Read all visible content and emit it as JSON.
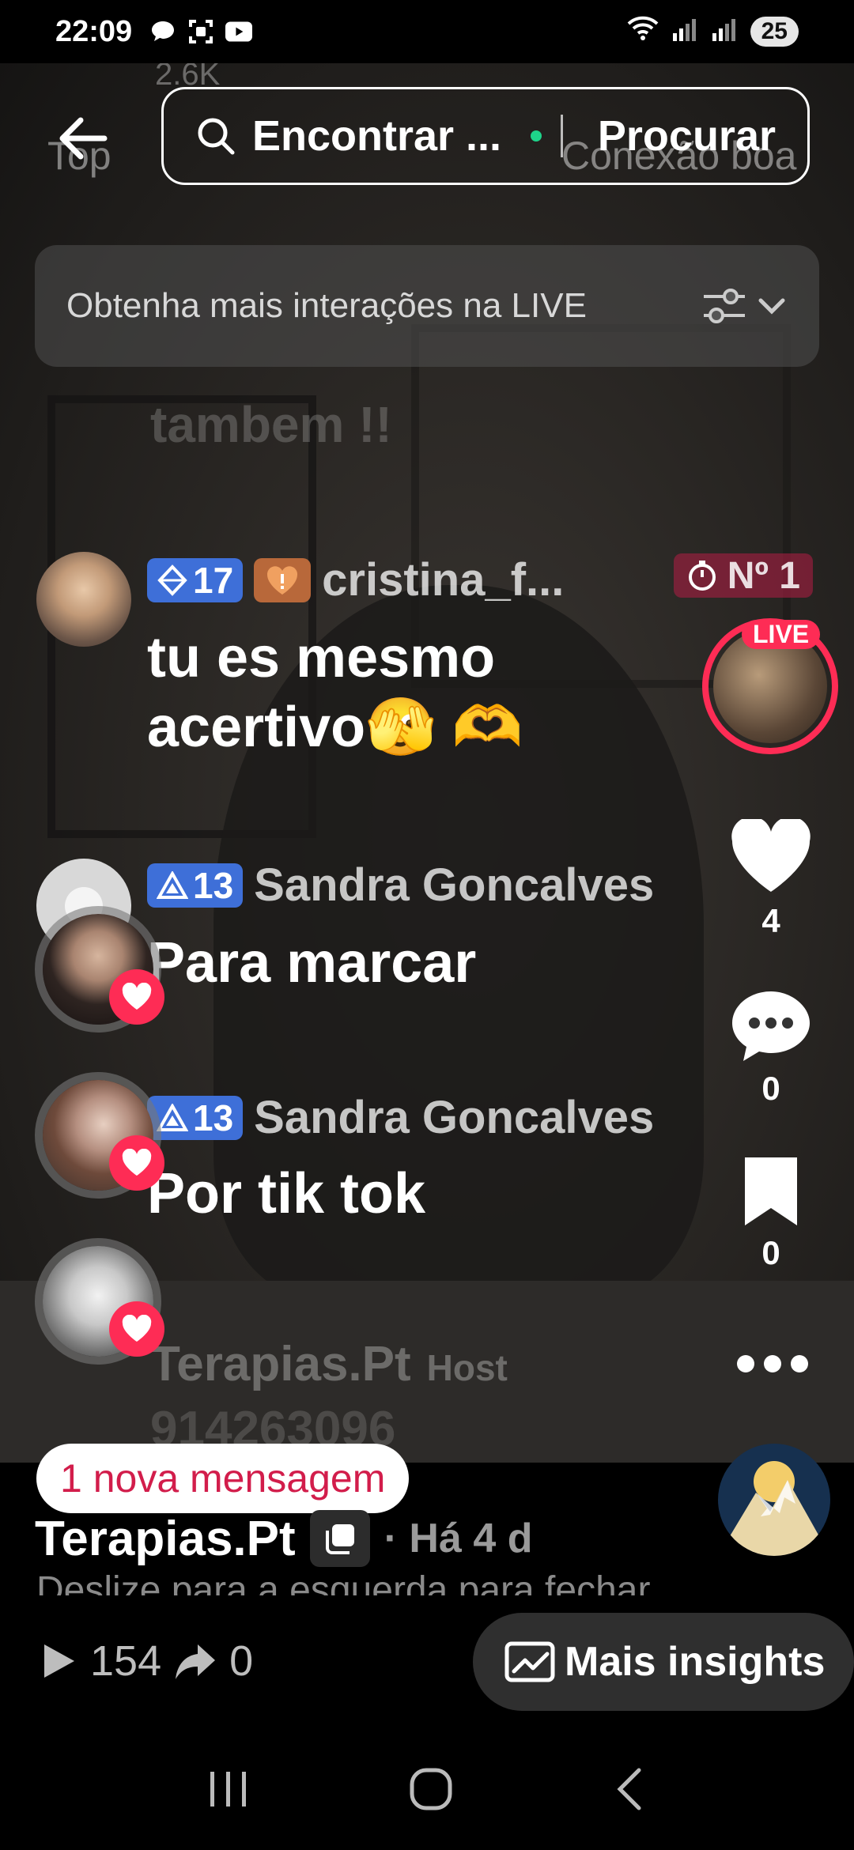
{
  "status_bar": {
    "time": "22:09",
    "battery": "25"
  },
  "header": {
    "viewer_count_ghost": "2.6K",
    "ghost_left": "Top",
    "ghost_right": "Conexão boa",
    "search_placeholder": "Encontrar ...",
    "search_button": "Procurar"
  },
  "banner": {
    "text": "Obtenha mais interações na LIVE"
  },
  "comments": {
    "ghost_top": "tambem !!",
    "c1": {
      "level": "17",
      "username": "cristina_f...",
      "rank": "Nº 1",
      "message": "tu es mesmo acertivo🫣 🫶"
    },
    "c2": {
      "level": "13",
      "username": "Sandra Goncalves",
      "message": "Para marcar"
    },
    "c3": {
      "level": "13",
      "username": "Sandra Goncalves",
      "message": "Por tik tok"
    },
    "host_ghost": "Terapias.Pt",
    "host_tag": "Host",
    "phone_ghost": "914263096"
  },
  "rail": {
    "live_label": "LIVE",
    "likes": "4",
    "comments": "0",
    "saves": "0"
  },
  "footer": {
    "new_message": "1 nova mensagem",
    "creator_name": "Terapias.Pt",
    "age": "· Há 4 d",
    "swipe_hint": "Deslize para a esquerda para fechar",
    "views": "154",
    "shares": "0",
    "insights": "Mais insights"
  },
  "colors": {
    "accent": "#fe2c55",
    "level_badge": "#3e6fd8"
  }
}
